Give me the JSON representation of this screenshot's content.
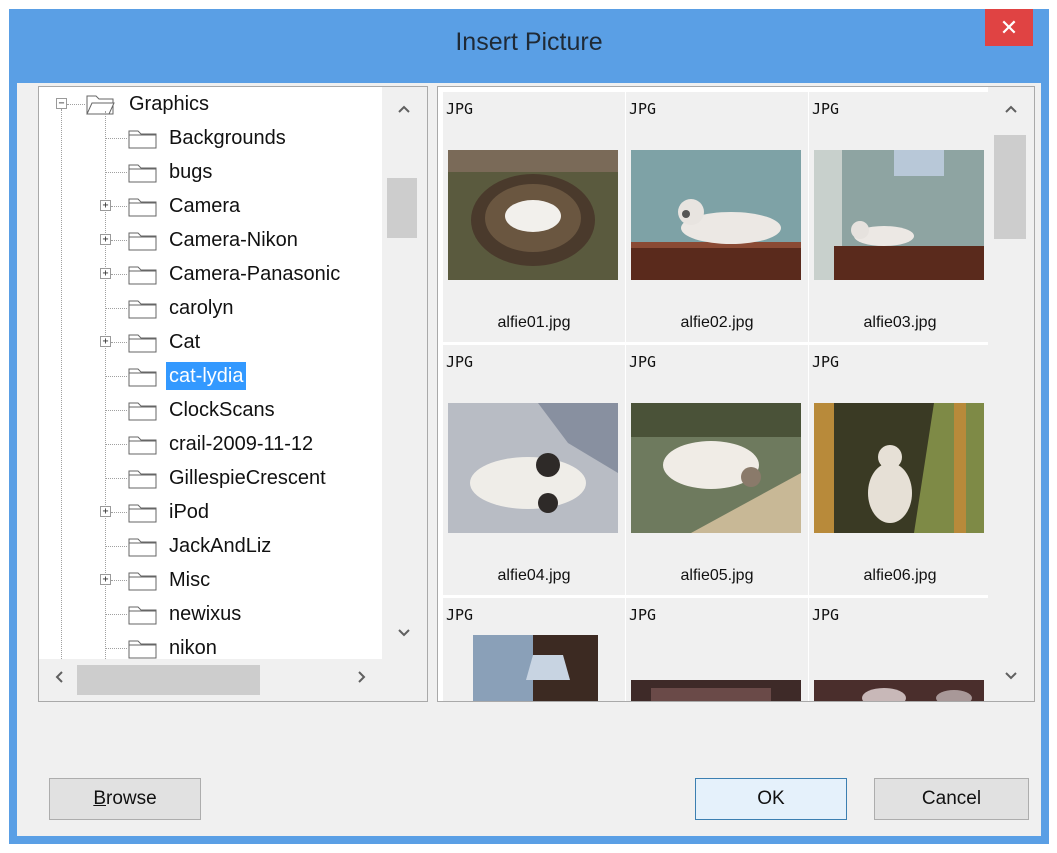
{
  "dialog": {
    "title": "Insert Picture",
    "close_glyph": "✕"
  },
  "tree": {
    "root": "Graphics",
    "items": [
      {
        "label": "Backgrounds",
        "expandable": false
      },
      {
        "label": "bugs",
        "expandable": false
      },
      {
        "label": "Camera",
        "expandable": true
      },
      {
        "label": "Camera-Nikon",
        "expandable": true
      },
      {
        "label": "Camera-Panasonic",
        "expandable": true
      },
      {
        "label": "carolyn",
        "expandable": false
      },
      {
        "label": "Cat",
        "expandable": true
      },
      {
        "label": "cat-lydia",
        "expandable": false,
        "selected": true
      },
      {
        "label": "ClockScans",
        "expandable": false
      },
      {
        "label": "crail-2009-11-12",
        "expandable": false
      },
      {
        "label": "GillespieCrescent",
        "expandable": false
      },
      {
        "label": "iPod",
        "expandable": true
      },
      {
        "label": "JackAndLiz",
        "expandable": false
      },
      {
        "label": "Misc",
        "expandable": true
      },
      {
        "label": "newixus",
        "expandable": false
      },
      {
        "label": "nikon",
        "expandable": false
      }
    ]
  },
  "thumbnails": [
    {
      "type": "JPG",
      "name": "alfie01.jpg"
    },
    {
      "type": "JPG",
      "name": "alfie02.jpg"
    },
    {
      "type": "JPG",
      "name": "alfie03.jpg"
    },
    {
      "type": "JPG",
      "name": "alfie04.jpg"
    },
    {
      "type": "JPG",
      "name": "alfie05.jpg"
    },
    {
      "type": "JPG",
      "name": "alfie06.jpg"
    },
    {
      "type": "JPG",
      "name": ""
    },
    {
      "type": "JPG",
      "name": ""
    },
    {
      "type": "JPG",
      "name": ""
    }
  ],
  "buttons": {
    "browse_accel": "B",
    "browse_rest": "rowse",
    "ok": "OK",
    "cancel": "Cancel"
  },
  "icons": {
    "scroll_up": "chevron-up-icon",
    "scroll_down": "chevron-down-icon",
    "scroll_left": "chevron-left-icon",
    "scroll_right": "chevron-right-icon",
    "folder": "folder-icon",
    "expand": "plus-box-icon",
    "collapse": "minus-box-icon"
  },
  "colors": {
    "title_bar": "#5a9fe5",
    "close_button": "#e04343",
    "selection": "#3399ff",
    "dialog_bg": "#f0f0f0"
  }
}
